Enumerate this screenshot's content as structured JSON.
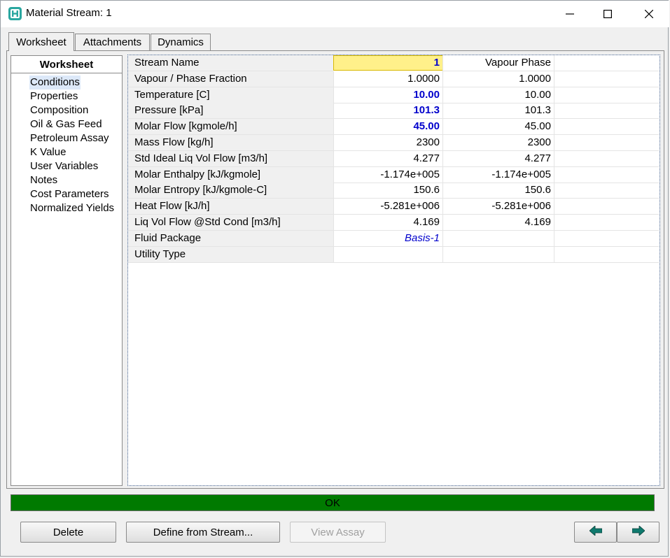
{
  "window": {
    "title": "Material Stream: 1",
    "app_icon": "hysys-app-icon",
    "controls": {
      "minimize": "minimize-icon",
      "maximize": "maximize-icon",
      "close": "close-icon"
    }
  },
  "tabs": [
    {
      "label": "Worksheet",
      "active": true
    },
    {
      "label": "Attachments",
      "active": false
    },
    {
      "label": "Dynamics",
      "active": false
    }
  ],
  "sidebar": {
    "header": "Worksheet",
    "items": [
      {
        "label": "Conditions",
        "selected": true
      },
      {
        "label": "Properties"
      },
      {
        "label": "Composition"
      },
      {
        "label": "Oil & Gas Feed"
      },
      {
        "label": "Petroleum Assay"
      },
      {
        "label": "K Value"
      },
      {
        "label": "User Variables"
      },
      {
        "label": "Notes"
      },
      {
        "label": "Cost Parameters"
      },
      {
        "label": "Normalized Yields"
      }
    ]
  },
  "grid": {
    "rows": [
      {
        "label": "Stream Name",
        "value": "1",
        "phase": "Vapour Phase",
        "style": "selected"
      },
      {
        "label": "Vapour / Phase Fraction",
        "value": "1.0000",
        "phase": "1.0000"
      },
      {
        "label": "Temperature [C]",
        "value": "10.00",
        "phase": "10.00",
        "style": "spec"
      },
      {
        "label": "Pressure [kPa]",
        "value": "101.3",
        "phase": "101.3",
        "style": "spec"
      },
      {
        "label": "Molar Flow [kgmole/h]",
        "value": "45.00",
        "phase": "45.00",
        "style": "spec"
      },
      {
        "label": "Mass Flow [kg/h]",
        "value": "2300",
        "phase": "2300"
      },
      {
        "label": "Std Ideal Liq Vol Flow [m3/h]",
        "value": "4.277",
        "phase": "4.277"
      },
      {
        "label": "Molar Enthalpy [kJ/kgmole]",
        "value": "-1.174e+005",
        "phase": "-1.174e+005"
      },
      {
        "label": "Molar Entropy [kJ/kgmole-C]",
        "value": "150.6",
        "phase": "150.6"
      },
      {
        "label": "Heat Flow [kJ/h]",
        "value": "-5.281e+006",
        "phase": "-5.281e+006"
      },
      {
        "label": "Liq Vol Flow @Std Cond [m3/h]",
        "value": "4.169",
        "phase": "4.169"
      },
      {
        "label": "Fluid Package",
        "value": "Basis-1",
        "phase": "",
        "style": "link"
      },
      {
        "label": "Utility Type",
        "value": "",
        "phase": ""
      }
    ]
  },
  "status": {
    "text": "OK",
    "color": "#007a00"
  },
  "buttons": {
    "delete": "Delete",
    "define_from_stream": "Define from Stream...",
    "view_assay": "View Assay",
    "prev_icon": "arrow-left-icon",
    "next_icon": "arrow-right-icon"
  },
  "colors": {
    "spec_blue": "#0000cc",
    "selected_yellow": "#fff08a",
    "arrow_teal": "#0f7a6e"
  }
}
